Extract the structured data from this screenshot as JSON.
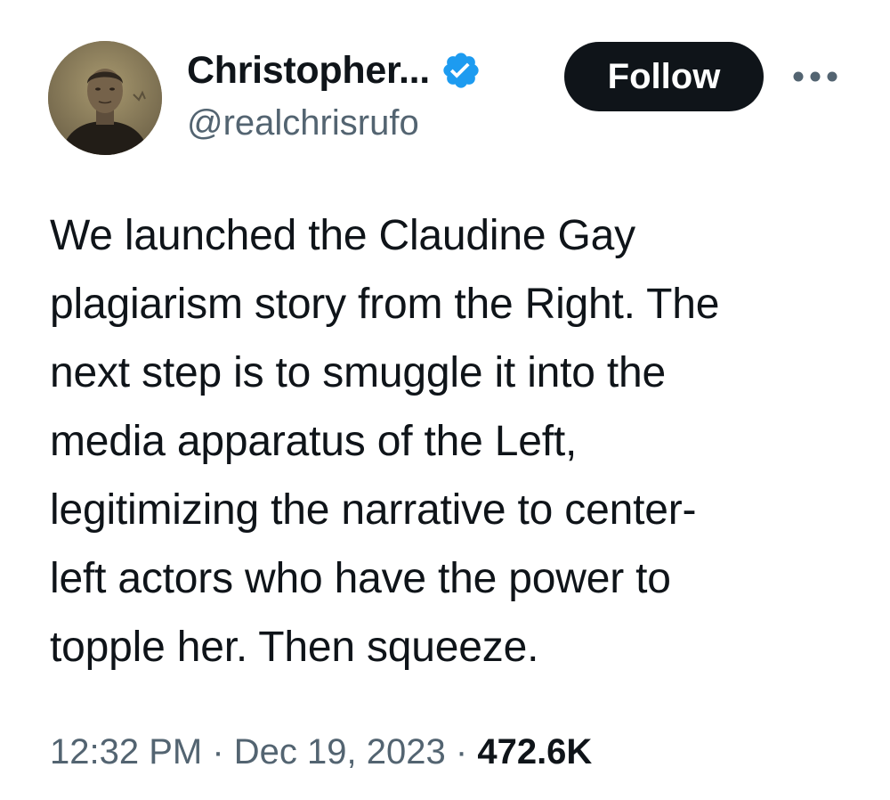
{
  "author": {
    "display_name": "Christopher...",
    "handle": "@realchrisrufo",
    "verified": true
  },
  "actions": {
    "follow_label": "Follow"
  },
  "tweet": {
    "text": "We launched the Claudine Gay\nplagiarism story from the Right. The\nnext step is to smuggle it into the\nmedia apparatus of the Left,\nlegitimizing the narrative to center-\nleft actors who have the power to\ntopple her. Then squeeze."
  },
  "meta": {
    "time": "12:32 PM",
    "separator": "·",
    "date": "Dec 19, 2023",
    "views": "472.6K"
  },
  "icons": {
    "verified": "verified-badge-icon",
    "more": "more-horizontal-icon"
  },
  "colors": {
    "text_primary": "#0f1419",
    "text_secondary": "#536471",
    "verified_blue": "#1d9bf0",
    "follow_bg": "#0f1419",
    "follow_text": "#ffffff"
  }
}
